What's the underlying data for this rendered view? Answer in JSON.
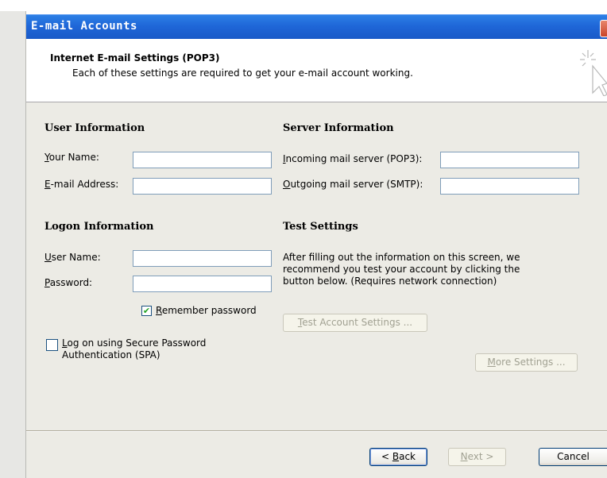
{
  "window": {
    "title": "E-mail Accounts"
  },
  "header": {
    "title": "Internet E-mail Settings (POP3)",
    "subtitle": "Each of these settings are required to get your e-mail account working."
  },
  "user_info": {
    "heading": "User Information",
    "name_label_u": "Y",
    "name_label_rest": "our Name:",
    "name_value": "",
    "email_label_u": "E",
    "email_label_rest": "-mail Address:",
    "email_value": ""
  },
  "server_info": {
    "heading": "Server Information",
    "incoming_label_u": "I",
    "incoming_label_rest": "ncoming mail server (POP3):",
    "incoming_value": "",
    "outgoing_label_u": "O",
    "outgoing_label_rest": "utgoing mail server (SMTP):",
    "outgoing_value": ""
  },
  "logon_info": {
    "heading": "Logon Information",
    "username_label_u": "U",
    "username_label_rest": "ser Name:",
    "username_value": "",
    "password_label_u": "P",
    "password_label_rest": "assword:",
    "password_value": "",
    "remember_label_u": "R",
    "remember_label_rest": "emember password",
    "remember_checked": true,
    "spa_label_u": "L",
    "spa_label_rest": "og on using Secure Password",
    "spa_label_line2": "Authentication (SPA)",
    "spa_checked": false
  },
  "test_settings": {
    "heading": "Test Settings",
    "desc_line1": "After filling out the information on this screen, we",
    "desc_line2": "recommend you test your account by clicking the",
    "desc_line3": "button below. (Requires network connection)",
    "test_button_u": "T",
    "test_button_rest": "est Account Settings ..."
  },
  "more_settings": {
    "label_u": "M",
    "label_rest": "ore Settings ..."
  },
  "nav": {
    "back_pre": "< ",
    "back_u": "B",
    "back_rest": "ack",
    "next_u": "N",
    "next_rest": "ext >",
    "cancel_label": "Cancel"
  },
  "icons": {
    "wizard": "cursor-sparkle-icon",
    "check": "✔"
  }
}
